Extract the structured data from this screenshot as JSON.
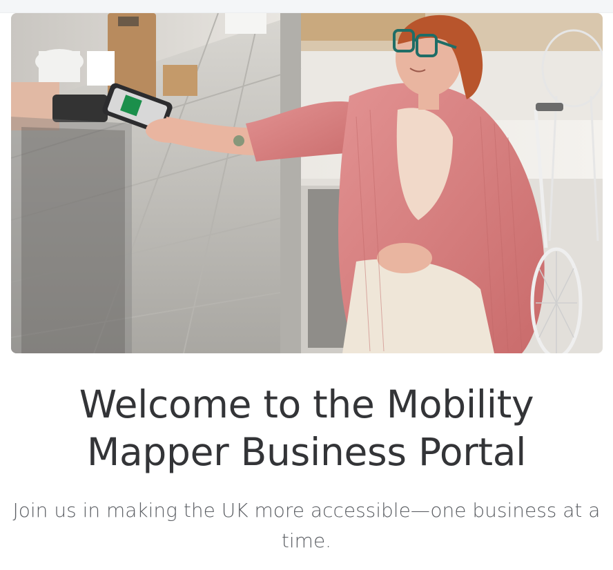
{
  "hero": {
    "image_name": "woman-in-wheelchair-paying-with-phone"
  },
  "title": {
    "line1": "Welcome to the Mobility",
    "line2": "Mapper Business Portal"
  },
  "subtitle": {
    "line1": "Join us in making the UK more accessible—one business at a",
    "line2": "time."
  },
  "colors": {
    "title": "#333437",
    "subtitle": "#5b5e63",
    "jacket": "#d67c7c",
    "hair": "#b8552c",
    "counter": "#d3d1cc"
  }
}
